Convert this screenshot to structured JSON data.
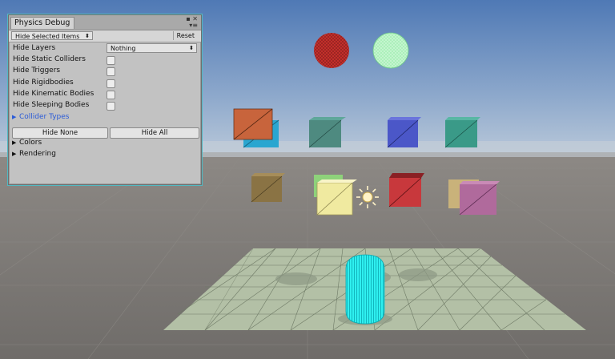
{
  "window": {
    "tab_title": "Physics Debug",
    "menu_icon": "window-menu-icon",
    "hide_selected_items": "Hide Selected Items",
    "reset_label": "Reset"
  },
  "settings": {
    "hide_layers_label": "Hide Layers",
    "hide_layers_value": "Nothing",
    "hide_static_colliders": "Hide Static Colliders",
    "hide_triggers": "Hide Triggers",
    "hide_rigidbodies": "Hide Rigidbodies",
    "hide_kinematic_bodies": "Hide Kinematic Bodies",
    "hide_sleeping_bodies": "Hide Sleeping Bodies",
    "checkbox_states": [
      false,
      false,
      false,
      false,
      false
    ],
    "collider_types": "Collider Types",
    "hide_none": "Hide None",
    "hide_all": "Hide All",
    "colors": "Colors",
    "rendering": "Rendering"
  },
  "scene": {
    "objects": [
      {
        "name": "red-sphere",
        "color": "#c8302c"
      },
      {
        "name": "green-sphere",
        "color": "#a8f0b8"
      },
      {
        "name": "orange-cube",
        "color": "#c8643c"
      },
      {
        "name": "cyan-cube",
        "color": "#2aa6d0"
      },
      {
        "name": "teal-cube",
        "color": "#4e8a80"
      },
      {
        "name": "blue-cube",
        "color": "#4b57c8"
      },
      {
        "name": "teal-cube-right",
        "color": "#3a9a88"
      },
      {
        "name": "brown-cube",
        "color": "#8a7344"
      },
      {
        "name": "yellow-cube",
        "color": "#f0eaa0"
      },
      {
        "name": "red-cube",
        "color": "#c8383c"
      },
      {
        "name": "purple-cube",
        "color": "#b06a9c"
      },
      {
        "name": "capsule",
        "color": "#2ff0f0"
      },
      {
        "name": "ground-plane",
        "color": "#b3c0a6"
      }
    ]
  }
}
